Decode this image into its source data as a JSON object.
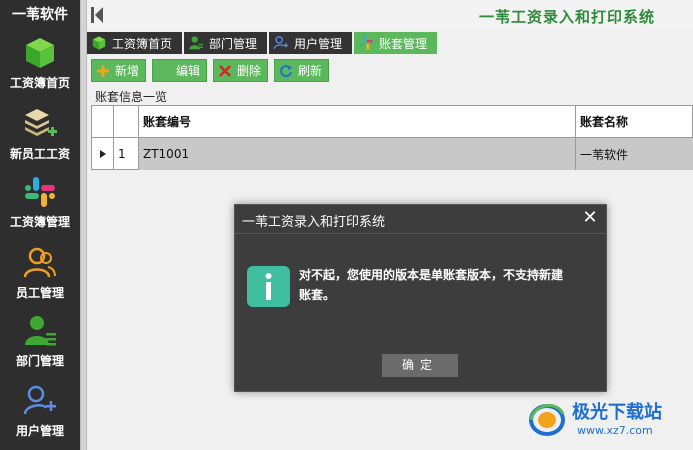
{
  "sidebar": {
    "title": "一苇软件",
    "items": [
      {
        "label": "工资簿首页",
        "icon": "green-cube-icon"
      },
      {
        "label": "新员工工资",
        "icon": "layers-plus-icon"
      },
      {
        "label": "工资簿管理",
        "icon": "colorful-grid-icon"
      },
      {
        "label": "员工管理",
        "icon": "users-icon"
      },
      {
        "label": "部门管理",
        "icon": "department-user-icon"
      },
      {
        "label": "用户管理",
        "icon": "user-add-icon"
      }
    ]
  },
  "header": {
    "title": "一苇工资录入和打印系统"
  },
  "tabs": [
    {
      "label": "工资簿首页",
      "icon": "green-cube-icon",
      "active": false
    },
    {
      "label": "部门管理",
      "icon": "department-user-icon",
      "active": false
    },
    {
      "label": "用户管理",
      "icon": "user-add-icon",
      "active": false
    },
    {
      "label": "账套管理",
      "icon": "colorful-grid-icon",
      "active": true
    }
  ],
  "toolbar": {
    "add": "新增",
    "edit": "编辑",
    "delete": "删除",
    "refresh": "刷新"
  },
  "section_label": "账套信息一览",
  "table": {
    "columns": [
      "账套编号",
      "账套名称"
    ],
    "rows": [
      {
        "num": "1",
        "code": "ZT1001",
        "name": "一苇软件"
      }
    ]
  },
  "dialog": {
    "title": "一苇工资录入和打印系统",
    "close": "✕",
    "message": "对不起，您使用的版本是单账套版本，不支持新建账套。",
    "ok": "确定"
  },
  "watermark": {
    "text": "极光下载站",
    "url": "www.xz7.com"
  },
  "colors": {
    "accent_green": "#5cb85c",
    "sidebar_bg": "#2e2e2e",
    "dialog_bg": "#3d3d3d",
    "info_icon": "#3fbf9f"
  }
}
